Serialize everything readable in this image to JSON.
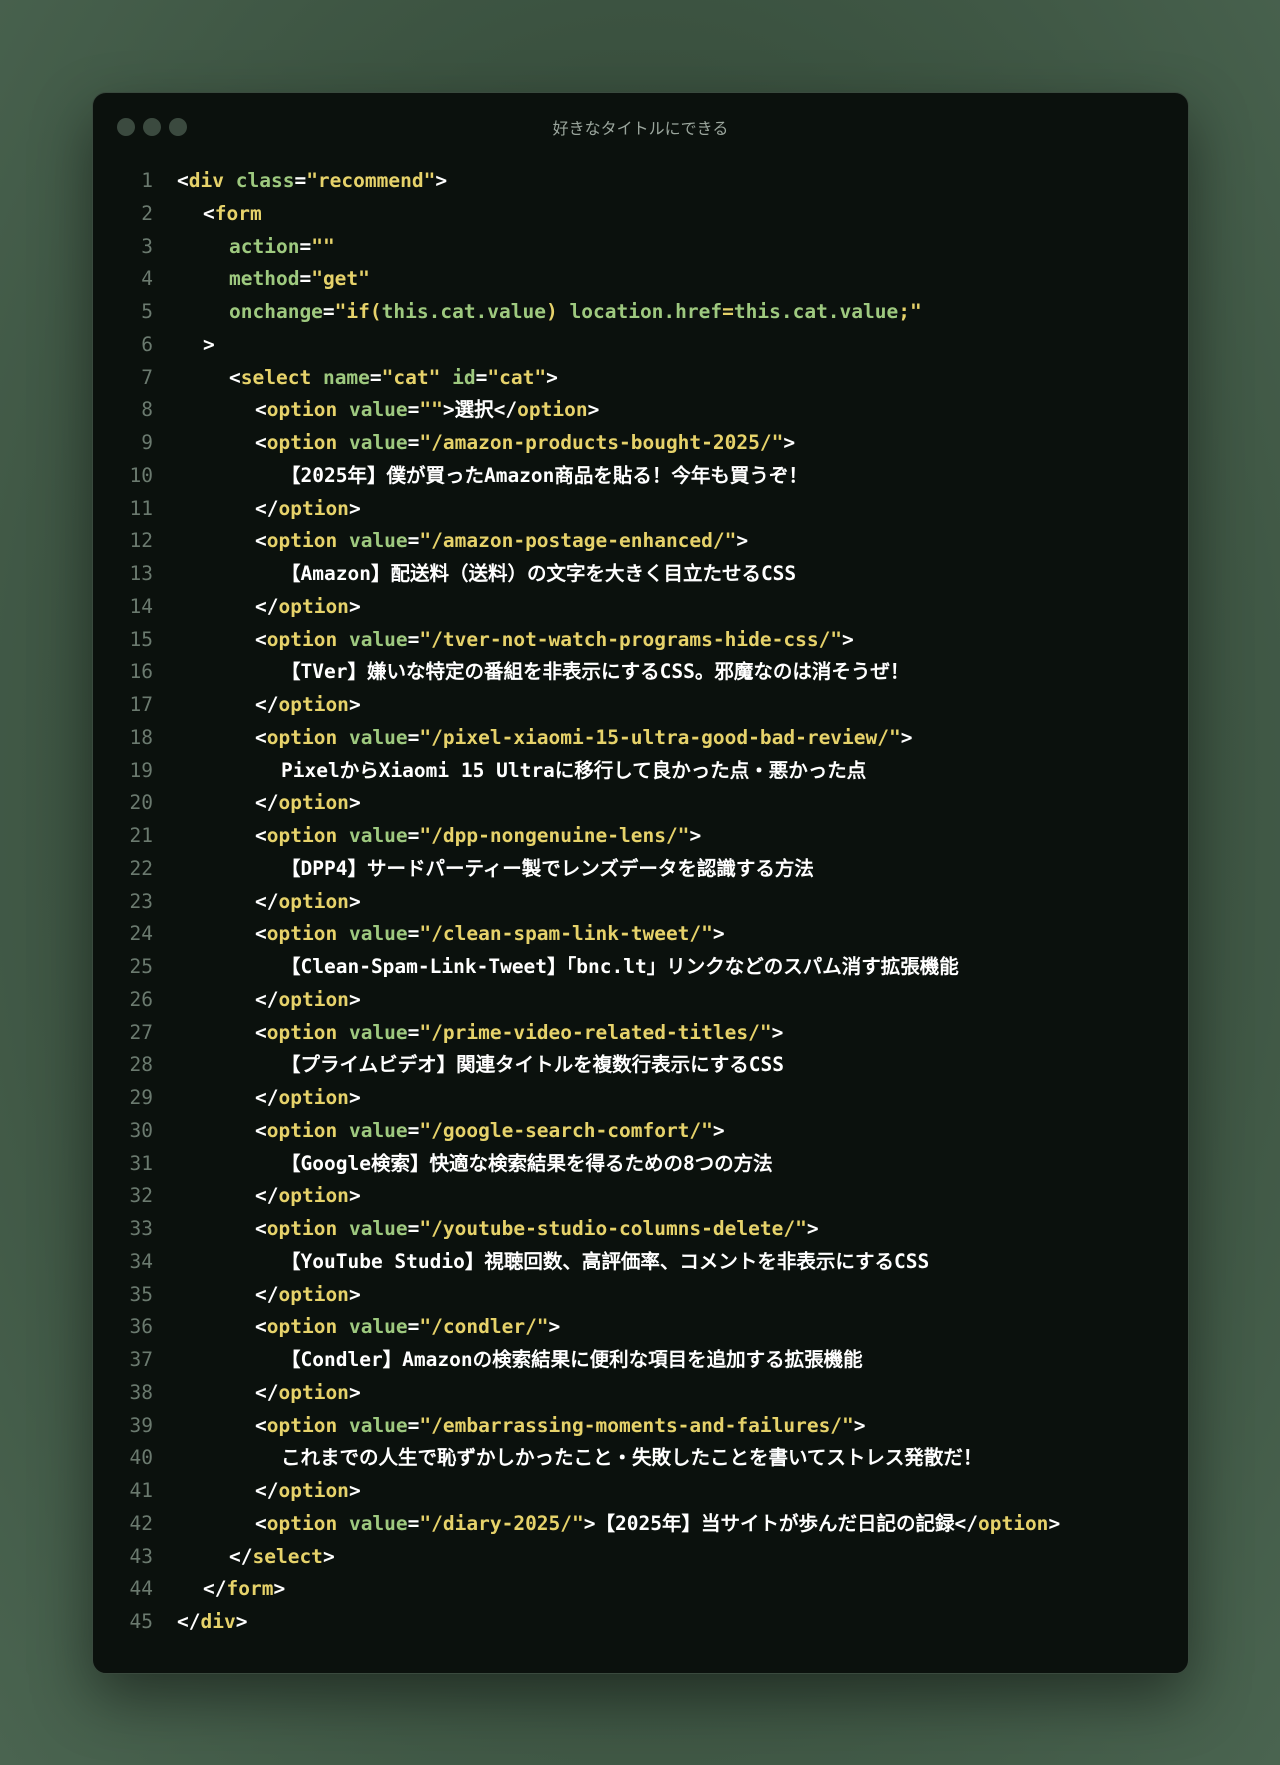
{
  "window": {
    "title": "好きなタイトルにできる"
  },
  "code": {
    "lines": [
      {
        "n": "1",
        "i": 0,
        "t": [
          [
            "pn",
            "<"
          ],
          [
            "tg",
            "div"
          ],
          [
            "pn",
            " "
          ],
          [
            "at",
            "class"
          ],
          [
            "pn",
            "="
          ],
          [
            "st",
            "\"recommend\""
          ],
          [
            "pn",
            ">"
          ]
        ]
      },
      {
        "n": "2",
        "i": 1,
        "t": [
          [
            "pn",
            "<"
          ],
          [
            "tg",
            "form"
          ]
        ]
      },
      {
        "n": "3",
        "i": 2,
        "t": [
          [
            "at",
            "action"
          ],
          [
            "pn",
            "="
          ],
          [
            "st",
            "\"\""
          ]
        ]
      },
      {
        "n": "4",
        "i": 2,
        "t": [
          [
            "at",
            "method"
          ],
          [
            "pn",
            "="
          ],
          [
            "st",
            "\"get\""
          ]
        ]
      },
      {
        "n": "5",
        "i": 2,
        "t": [
          [
            "at",
            "onchange"
          ],
          [
            "pn",
            "="
          ],
          [
            "st",
            "\"if("
          ],
          [
            "js",
            "this.cat.value"
          ],
          [
            "st",
            ")"
          ],
          [
            "js",
            " location.href"
          ],
          [
            "st",
            "="
          ],
          [
            "js",
            "this.cat.value"
          ],
          [
            "st",
            ";\""
          ]
        ]
      },
      {
        "n": "6",
        "i": 1,
        "t": [
          [
            "pn",
            ">"
          ]
        ]
      },
      {
        "n": "7",
        "i": 2,
        "t": [
          [
            "pn",
            "<"
          ],
          [
            "tg",
            "select"
          ],
          [
            "pn",
            " "
          ],
          [
            "at",
            "name"
          ],
          [
            "pn",
            "="
          ],
          [
            "st",
            "\"cat\""
          ],
          [
            "pn",
            " "
          ],
          [
            "at",
            "id"
          ],
          [
            "pn",
            "="
          ],
          [
            "st",
            "\"cat\""
          ],
          [
            "pn",
            ">"
          ]
        ]
      },
      {
        "n": "8",
        "i": 3,
        "t": [
          [
            "pn",
            "<"
          ],
          [
            "tg",
            "option"
          ],
          [
            "pn",
            " "
          ],
          [
            "at",
            "value"
          ],
          [
            "pn",
            "="
          ],
          [
            "st",
            "\"\""
          ],
          [
            "pn",
            ">"
          ],
          [
            "tx",
            "選択"
          ],
          [
            "pn",
            "</"
          ],
          [
            "tg",
            "option"
          ],
          [
            "pn",
            ">"
          ]
        ]
      },
      {
        "n": "9",
        "i": 3,
        "t": [
          [
            "pn",
            "<"
          ],
          [
            "tg",
            "option"
          ],
          [
            "pn",
            " "
          ],
          [
            "at",
            "value"
          ],
          [
            "pn",
            "="
          ],
          [
            "st",
            "\"/amazon-products-bought-2025/\""
          ],
          [
            "pn",
            ">"
          ]
        ]
      },
      {
        "n": "10",
        "i": 4,
        "t": [
          [
            "tx",
            "【2025年】僕が買ったAmazon商品を貼る！今年も買うぞ！"
          ]
        ]
      },
      {
        "n": "11",
        "i": 3,
        "t": [
          [
            "pn",
            "</"
          ],
          [
            "tg",
            "option"
          ],
          [
            "pn",
            ">"
          ]
        ]
      },
      {
        "n": "12",
        "i": 3,
        "t": [
          [
            "pn",
            "<"
          ],
          [
            "tg",
            "option"
          ],
          [
            "pn",
            " "
          ],
          [
            "at",
            "value"
          ],
          [
            "pn",
            "="
          ],
          [
            "st",
            "\"/amazon-postage-enhanced/\""
          ],
          [
            "pn",
            ">"
          ]
        ]
      },
      {
        "n": "13",
        "i": 4,
        "t": [
          [
            "tx",
            "【Amazon】配送料（送料）の文字を大きく目立たせるCSS"
          ]
        ]
      },
      {
        "n": "14",
        "i": 3,
        "t": [
          [
            "pn",
            "</"
          ],
          [
            "tg",
            "option"
          ],
          [
            "pn",
            ">"
          ]
        ]
      },
      {
        "n": "15",
        "i": 3,
        "t": [
          [
            "pn",
            "<"
          ],
          [
            "tg",
            "option"
          ],
          [
            "pn",
            " "
          ],
          [
            "at",
            "value"
          ],
          [
            "pn",
            "="
          ],
          [
            "st",
            "\"/tver-not-watch-programs-hide-css/\""
          ],
          [
            "pn",
            ">"
          ]
        ]
      },
      {
        "n": "16",
        "i": 4,
        "t": [
          [
            "tx",
            "【TVer】嫌いな特定の番組を非表示にするCSS。邪魔なのは消そうぜ！"
          ]
        ]
      },
      {
        "n": "17",
        "i": 3,
        "t": [
          [
            "pn",
            "</"
          ],
          [
            "tg",
            "option"
          ],
          [
            "pn",
            ">"
          ]
        ]
      },
      {
        "n": "18",
        "i": 3,
        "t": [
          [
            "pn",
            "<"
          ],
          [
            "tg",
            "option"
          ],
          [
            "pn",
            " "
          ],
          [
            "at",
            "value"
          ],
          [
            "pn",
            "="
          ],
          [
            "st",
            "\"/pixel-xiaomi-15-ultra-good-bad-review/\""
          ],
          [
            "pn",
            ">"
          ]
        ]
      },
      {
        "n": "19",
        "i": 4,
        "t": [
          [
            "tx",
            "PixelからXiaomi 15 Ultraに移行して良かった点・悪かった点"
          ]
        ]
      },
      {
        "n": "20",
        "i": 3,
        "t": [
          [
            "pn",
            "</"
          ],
          [
            "tg",
            "option"
          ],
          [
            "pn",
            ">"
          ]
        ]
      },
      {
        "n": "21",
        "i": 3,
        "t": [
          [
            "pn",
            "<"
          ],
          [
            "tg",
            "option"
          ],
          [
            "pn",
            " "
          ],
          [
            "at",
            "value"
          ],
          [
            "pn",
            "="
          ],
          [
            "st",
            "\"/dpp-nongenuine-lens/\""
          ],
          [
            "pn",
            ">"
          ]
        ]
      },
      {
        "n": "22",
        "i": 4,
        "t": [
          [
            "tx",
            "【DPP4】サードパーティー製でレンズデータを認識する方法"
          ]
        ]
      },
      {
        "n": "23",
        "i": 3,
        "t": [
          [
            "pn",
            "</"
          ],
          [
            "tg",
            "option"
          ],
          [
            "pn",
            ">"
          ]
        ]
      },
      {
        "n": "24",
        "i": 3,
        "t": [
          [
            "pn",
            "<"
          ],
          [
            "tg",
            "option"
          ],
          [
            "pn",
            " "
          ],
          [
            "at",
            "value"
          ],
          [
            "pn",
            "="
          ],
          [
            "st",
            "\"/clean-spam-link-tweet/\""
          ],
          [
            "pn",
            ">"
          ]
        ]
      },
      {
        "n": "25",
        "i": 4,
        "t": [
          [
            "tx",
            "【Clean-Spam-Link-Tweet】「bnc.lt」リンクなどのスパム消す拡張機能"
          ]
        ]
      },
      {
        "n": "26",
        "i": 3,
        "t": [
          [
            "pn",
            "</"
          ],
          [
            "tg",
            "option"
          ],
          [
            "pn",
            ">"
          ]
        ]
      },
      {
        "n": "27",
        "i": 3,
        "t": [
          [
            "pn",
            "<"
          ],
          [
            "tg",
            "option"
          ],
          [
            "pn",
            " "
          ],
          [
            "at",
            "value"
          ],
          [
            "pn",
            "="
          ],
          [
            "st",
            "\"/prime-video-related-titles/\""
          ],
          [
            "pn",
            ">"
          ]
        ]
      },
      {
        "n": "28",
        "i": 4,
        "t": [
          [
            "tx",
            "【プライムビデオ】関連タイトルを複数行表示にするCSS"
          ]
        ]
      },
      {
        "n": "29",
        "i": 3,
        "t": [
          [
            "pn",
            "</"
          ],
          [
            "tg",
            "option"
          ],
          [
            "pn",
            ">"
          ]
        ]
      },
      {
        "n": "30",
        "i": 3,
        "t": [
          [
            "pn",
            "<"
          ],
          [
            "tg",
            "option"
          ],
          [
            "pn",
            " "
          ],
          [
            "at",
            "value"
          ],
          [
            "pn",
            "="
          ],
          [
            "st",
            "\"/google-search-comfort/\""
          ],
          [
            "pn",
            ">"
          ]
        ]
      },
      {
        "n": "31",
        "i": 4,
        "t": [
          [
            "tx",
            "【Google検索】快適な検索結果を得るための8つの方法"
          ]
        ]
      },
      {
        "n": "32",
        "i": 3,
        "t": [
          [
            "pn",
            "</"
          ],
          [
            "tg",
            "option"
          ],
          [
            "pn",
            ">"
          ]
        ]
      },
      {
        "n": "33",
        "i": 3,
        "t": [
          [
            "pn",
            "<"
          ],
          [
            "tg",
            "option"
          ],
          [
            "pn",
            " "
          ],
          [
            "at",
            "value"
          ],
          [
            "pn",
            "="
          ],
          [
            "st",
            "\"/youtube-studio-columns-delete/\""
          ],
          [
            "pn",
            ">"
          ]
        ]
      },
      {
        "n": "34",
        "i": 4,
        "t": [
          [
            "tx",
            "【YouTube Studio】視聴回数、高評価率、コメントを非表示にするCSS"
          ]
        ]
      },
      {
        "n": "35",
        "i": 3,
        "t": [
          [
            "pn",
            "</"
          ],
          [
            "tg",
            "option"
          ],
          [
            "pn",
            ">"
          ]
        ]
      },
      {
        "n": "36",
        "i": 3,
        "t": [
          [
            "pn",
            "<"
          ],
          [
            "tg",
            "option"
          ],
          [
            "pn",
            " "
          ],
          [
            "at",
            "value"
          ],
          [
            "pn",
            "="
          ],
          [
            "st",
            "\"/condler/\""
          ],
          [
            "pn",
            ">"
          ]
        ]
      },
      {
        "n": "37",
        "i": 4,
        "t": [
          [
            "tx",
            "【Condler】Amazonの検索結果に便利な項目を追加する拡張機能"
          ]
        ]
      },
      {
        "n": "38",
        "i": 3,
        "t": [
          [
            "pn",
            "</"
          ],
          [
            "tg",
            "option"
          ],
          [
            "pn",
            ">"
          ]
        ]
      },
      {
        "n": "39",
        "i": 3,
        "t": [
          [
            "pn",
            "<"
          ],
          [
            "tg",
            "option"
          ],
          [
            "pn",
            " "
          ],
          [
            "at",
            "value"
          ],
          [
            "pn",
            "="
          ],
          [
            "st",
            "\"/embarrassing-moments-and-failures/\""
          ],
          [
            "pn",
            ">"
          ]
        ]
      },
      {
        "n": "40",
        "i": 4,
        "t": [
          [
            "tx",
            "これまでの人生で恥ずかしかったこと・失敗したことを書いてストレス発散だ！"
          ]
        ]
      },
      {
        "n": "41",
        "i": 3,
        "t": [
          [
            "pn",
            "</"
          ],
          [
            "tg",
            "option"
          ],
          [
            "pn",
            ">"
          ]
        ]
      },
      {
        "n": "42",
        "i": 3,
        "t": [
          [
            "pn",
            "<"
          ],
          [
            "tg",
            "option"
          ],
          [
            "pn",
            " "
          ],
          [
            "at",
            "value"
          ],
          [
            "pn",
            "="
          ],
          [
            "st",
            "\"/diary-2025/\""
          ],
          [
            "pn",
            ">"
          ],
          [
            "tx",
            "【2025年】当サイトが歩んだ日記の記録"
          ],
          [
            "pn",
            "</"
          ],
          [
            "tg",
            "option"
          ],
          [
            "pn",
            ">"
          ]
        ]
      },
      {
        "n": "43",
        "i": 2,
        "t": [
          [
            "pn",
            "</"
          ],
          [
            "tg",
            "select"
          ],
          [
            "pn",
            ">"
          ]
        ]
      },
      {
        "n": "44",
        "i": 1,
        "t": [
          [
            "pn",
            "</"
          ],
          [
            "tg",
            "form"
          ],
          [
            "pn",
            ">"
          ]
        ]
      },
      {
        "n": "45",
        "i": 0,
        "t": [
          [
            "pn",
            "</"
          ],
          [
            "tg",
            "div"
          ],
          [
            "pn",
            ">"
          ]
        ]
      }
    ]
  }
}
